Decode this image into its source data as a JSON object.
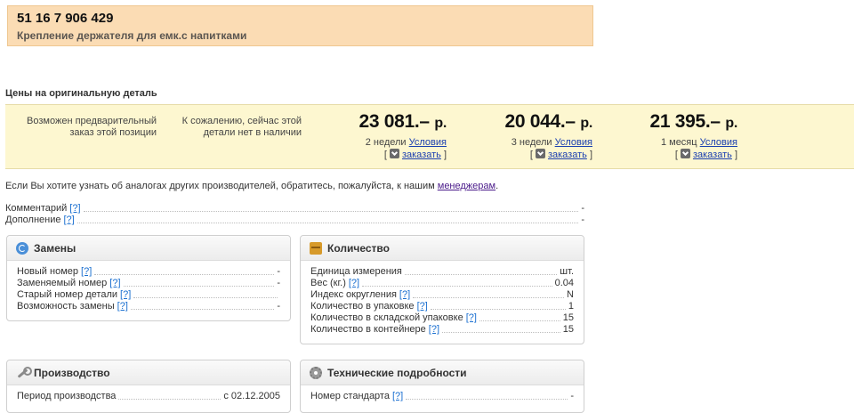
{
  "header": {
    "part_number": "51 16 7 906 429",
    "description": "Крепление держателя для емк.с напитками"
  },
  "prices_section": {
    "title": "Цены на оригинальную деталь",
    "note_preorder": "Возможен предварительный заказ этой позиции",
    "note_out_of_stock": "К сожалению, сейчас этой детали нет в наличии",
    "offers": [
      {
        "price": "23 081.–",
        "currency": "р.",
        "term": "2 недели",
        "conditions_label": "Условия",
        "order_label": "заказать"
      },
      {
        "price": "20 044.–",
        "currency": "р.",
        "term": "3 недели",
        "conditions_label": "Условия",
        "order_label": "заказать"
      },
      {
        "price": "21 395.–",
        "currency": "р.",
        "term": "1 месяц",
        "conditions_label": "Условия",
        "order_label": "заказать"
      }
    ],
    "bracket_open": "[",
    "bracket_close": "]"
  },
  "info": {
    "text": "Если Вы хотите узнать об аналогах других производителей, обратитесь, пожалуйста, к нашим",
    "link": "менеджерам",
    "after": "."
  },
  "help_mark": "[?]",
  "general_fields": [
    {
      "label": "Комментарий",
      "value": "-"
    },
    {
      "label": "Дополнение",
      "value": "-"
    }
  ],
  "panels": {
    "replacements": {
      "title": "Замены",
      "icon": "refresh-icon",
      "rows": [
        {
          "label": "Новый номер",
          "value": "-"
        },
        {
          "label": "Заменяемый номер",
          "value": "-"
        },
        {
          "label": "Старый номер детали",
          "value": ""
        },
        {
          "label": "Возможность замены",
          "value": "-"
        }
      ]
    },
    "quantity": {
      "title": "Количество",
      "icon": "box-icon",
      "rows": [
        {
          "label": "Единица измерения",
          "value": "шт.",
          "help": false
        },
        {
          "label": "Вес (кг.)",
          "value": "0.04",
          "help": true
        },
        {
          "label": "Индекс округления",
          "value": "N",
          "help": true
        },
        {
          "label": "Количество в упаковке",
          "value": "1",
          "help": true
        },
        {
          "label": "Количество в складской упаковке",
          "value": "15",
          "help": true
        },
        {
          "label": "Количество в контейнере",
          "value": "15",
          "help": true
        }
      ]
    },
    "production": {
      "title": "Производство",
      "icon": "wrench-icon",
      "rows": [
        {
          "label": "Период производства",
          "value": "с 02.12.2005"
        }
      ]
    },
    "technical": {
      "title": "Технические подробности",
      "icon": "gear-icon",
      "rows": [
        {
          "label": "Номер стандарта",
          "value": "-"
        }
      ]
    }
  }
}
